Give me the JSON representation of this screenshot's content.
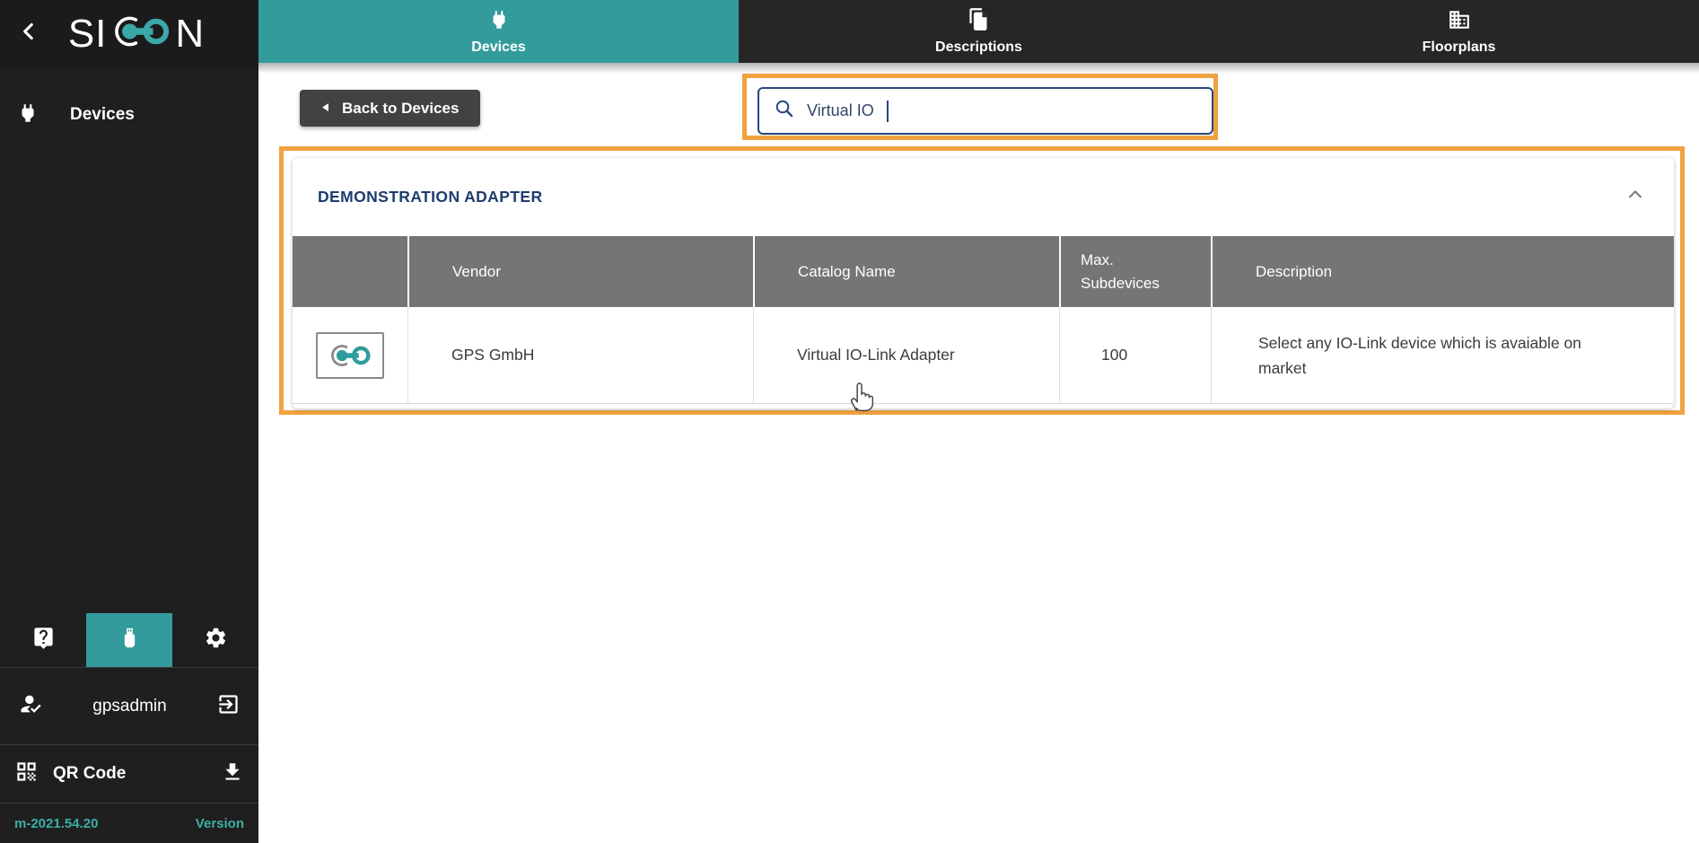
{
  "brand": {
    "name_prefix": "SI",
    "name_suffix": "N",
    "logo_mark": "co-link-mark"
  },
  "sidebar": {
    "nav": [
      {
        "label": "Devices",
        "icon": "plug-icon",
        "active": true
      }
    ],
    "tools": [
      {
        "icon": "help-icon",
        "active": false
      },
      {
        "icon": "usb-icon",
        "active": true
      },
      {
        "icon": "settings-icon",
        "active": false
      }
    ],
    "user": {
      "icon": "person-check-icon",
      "name": "gpsadmin",
      "logout_icon": "logout-icon"
    },
    "qr": {
      "icon": "qr-code-icon",
      "label": "QR Code",
      "download_icon": "download-icon"
    },
    "version": {
      "value": "m-2021.54.20",
      "label": "Version"
    }
  },
  "tabs": [
    {
      "label": "Devices",
      "icon": "plug-icon",
      "active": true
    },
    {
      "label": "Descriptions",
      "icon": "documents-icon",
      "active": false
    },
    {
      "label": "Floorplans",
      "icon": "building-icon",
      "active": false
    }
  ],
  "toolbar": {
    "back_button": "Back to Devices"
  },
  "search": {
    "value": "Virtual IO",
    "icon": "search-icon"
  },
  "panel": {
    "title": "DEMONSTRATION ADAPTER",
    "collapse_icon": "chevron-up-icon"
  },
  "table": {
    "headers": {
      "vendor": "Vendor",
      "catalog_name": "Catalog Name",
      "max_subdevices": "Max. Subdevices",
      "description": "Description"
    },
    "rows": [
      {
        "vendor": "GPS GmbH",
        "catalog_name": "Virtual IO-Link Adapter",
        "max_subdevices": "100",
        "description": "Select any IO-Link device which is avaiable on market"
      }
    ]
  },
  "colors": {
    "accent_teal": "#339B9C",
    "highlight_orange": "#F0A240",
    "navy": "#1F3C6E",
    "table_header_gray": "#757575",
    "sidebar_dark": "#1F1F1F",
    "topbar_dark": "#262626",
    "version_teal": "#3DAEA9"
  }
}
